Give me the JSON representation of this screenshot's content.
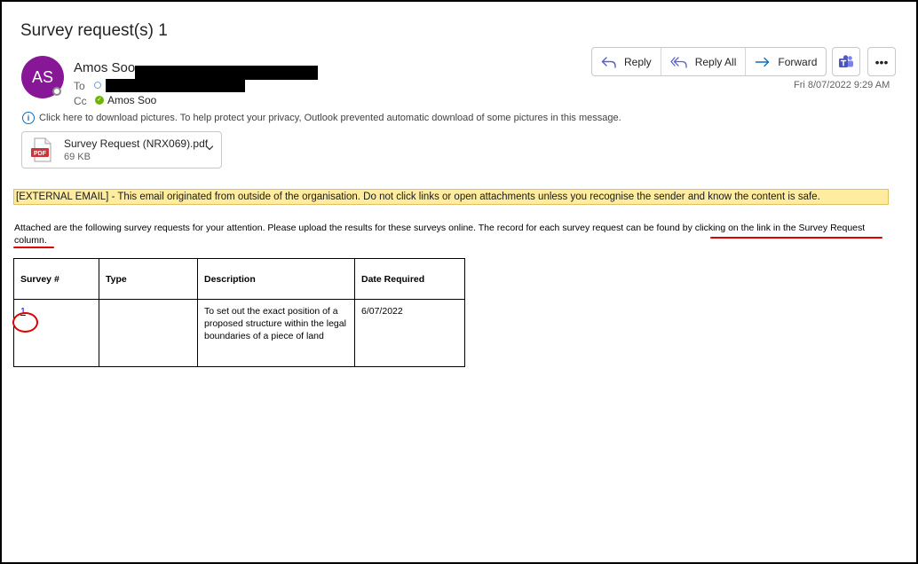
{
  "email": {
    "subject": "Survey request(s) 1",
    "avatar_initials": "AS",
    "sender_name": "Amos Soo",
    "to_label": "To",
    "cc_label": "Cc",
    "cc_name": "Amos Soo",
    "datetime": "Fri 8/07/2022 9:29 AM"
  },
  "actions": {
    "reply": "Reply",
    "reply_all": "Reply All",
    "forward": "Forward",
    "more": "•••"
  },
  "download_notice": "Click here to download pictures. To help protect your privacy, Outlook prevented automatic download of some pictures in this message.",
  "attachment": {
    "name": "Survey Request (NRX069).pdf",
    "size": "69 KB",
    "icon_label": "PDF"
  },
  "banner": "[EXTERNAL EMAIL] - This email originated from outside of the organisation. Do not click links or open attachments unless you recognise the sender and know the content is safe.",
  "body": {
    "text": "Attached are the following survey requests for your attention. Please upload the results for these surveys online. The record for each survey request can be found by clicking on the link in the Survey Request column."
  },
  "table": {
    "headers": [
      "Survey #",
      "Type",
      "Description",
      "Date Required"
    ],
    "rows": [
      {
        "survey": "1",
        "type": "",
        "description": "To set out the exact position of a proposed structure within the legal boundaries of a piece of land",
        "date": "6/07/2022"
      }
    ]
  },
  "colors": {
    "avatar": "#881798",
    "banner_bg": "#ffec9f",
    "annotation_red": "#e00000",
    "link": "#0000ee",
    "accent": "#0f6cbd"
  }
}
